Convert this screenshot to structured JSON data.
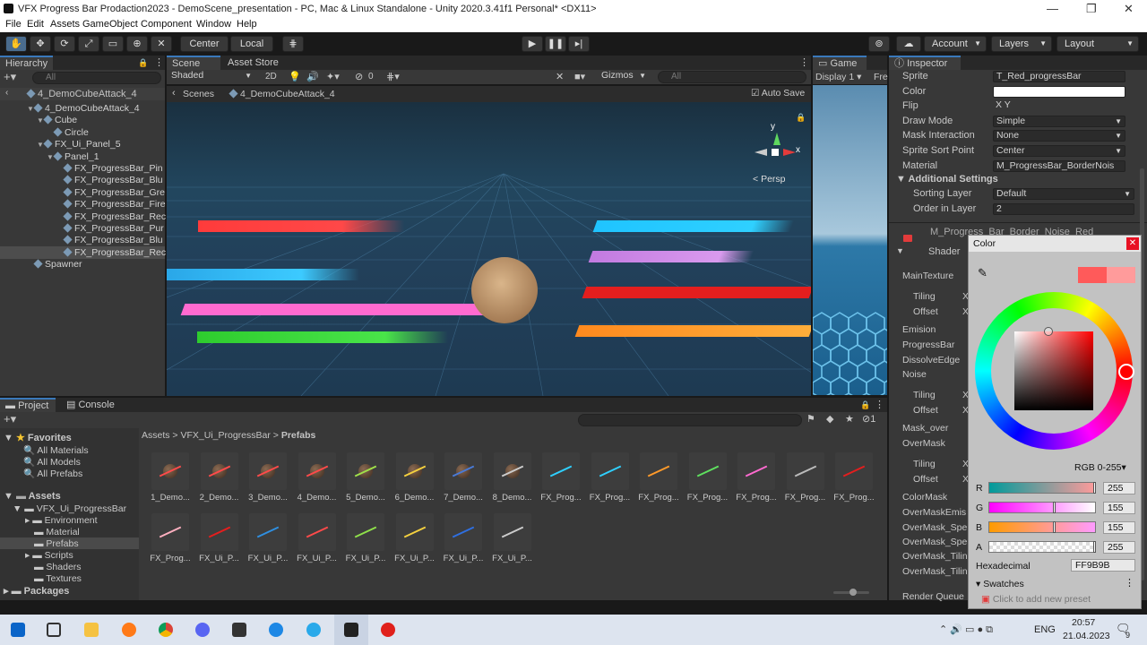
{
  "window": {
    "title": "VFX Progress Bar Prodaction2023 - DemoScene_presentation - PC, Mac & Linux Standalone - Unity 2020.3.41f1 Personal* <DX11>"
  },
  "menu": [
    "File",
    "Edit",
    "Assets",
    "GameObject",
    "Component",
    "Window",
    "Help"
  ],
  "toolbar": {
    "pivot": "Center",
    "space": "Local",
    "account": "Account",
    "layers": "Layers",
    "layout": "Layout"
  },
  "hierarchy": {
    "tab": "Hierarchy",
    "search_placeholder": "All",
    "scene_root": "4_DemoCubeAttack_4",
    "items": [
      {
        "label": "4_DemoCubeAttack_4",
        "depth": 1,
        "expand": "▼"
      },
      {
        "label": "Cube",
        "depth": 2,
        "expand": "▼"
      },
      {
        "label": "Circle",
        "depth": 3,
        "expand": ""
      },
      {
        "label": "FX_Ui_Panel_5",
        "depth": 2,
        "expand": "▼"
      },
      {
        "label": "Panel_1",
        "depth": 3,
        "expand": "▼"
      },
      {
        "label": "FX_ProgressBar_Pin",
        "depth": 4,
        "expand": ""
      },
      {
        "label": "FX_ProgressBar_Blu",
        "depth": 4,
        "expand": ""
      },
      {
        "label": "FX_ProgressBar_Gre",
        "depth": 4,
        "expand": ""
      },
      {
        "label": "FX_ProgressBar_Fire",
        "depth": 4,
        "expand": ""
      },
      {
        "label": "FX_ProgressBar_Rec",
        "depth": 4,
        "expand": ""
      },
      {
        "label": "FX_ProgressBar_Pur",
        "depth": 4,
        "expand": ""
      },
      {
        "label": "FX_ProgressBar_Blu",
        "depth": 4,
        "expand": ""
      },
      {
        "label": "FX_ProgressBar_Rec",
        "depth": 4,
        "expand": ""
      },
      {
        "label": "Spawner",
        "depth": 1,
        "expand": ""
      }
    ]
  },
  "scene": {
    "tabs": [
      "Scene",
      "Asset Store"
    ],
    "shading": "Shaded",
    "mode2d": "2D",
    "fx_count": "0",
    "gizmos": "Gizmos",
    "search_placeholder": "All",
    "breadcrumb_root": "Scenes",
    "breadcrumb_scene": "4_DemoCubeAttack_4",
    "autosave": "Auto Save",
    "persp": "Persp",
    "gizmo_y": "y",
    "gizmo_x": "x"
  },
  "game": {
    "tab": "Game",
    "display": "Display 1",
    "free": "Fre"
  },
  "inspector": {
    "tab": "Inspector",
    "rows": [
      {
        "label": "Sprite",
        "value": "T_Red_progressBar"
      },
      {
        "label": "Color",
        "value": ""
      },
      {
        "label": "Flip",
        "value": "X    Y"
      },
      {
        "label": "Draw Mode",
        "value": "Simple"
      },
      {
        "label": "Mask Interaction",
        "value": "None"
      },
      {
        "label": "Sprite Sort Point",
        "value": "Center"
      },
      {
        "label": "Material",
        "value": "M_ProgressBar_BorderNois"
      }
    ],
    "additional": "Additional Settings",
    "sorting_layer_label": "Sorting Layer",
    "sorting_layer": "Default",
    "order_label": "Order in Layer",
    "order": "2",
    "material_name": "M_Progress_Bar_Border_Noise_Red",
    "shader_label": "Shader",
    "props": [
      "MainTexture",
      "Tiling",
      "Offset",
      "Emision",
      "ProgressBar",
      "DissolveEdge",
      "Noise",
      "Tiling",
      "Offset",
      "Mask_over",
      "OverMask",
      "Tiling",
      "Offset",
      "ColorMask",
      "OverMaskEmis",
      "OverMask_Spe",
      "OverMask_Spe",
      "OverMask_Tilin",
      "OverMask_Tilin",
      "Render Queue"
    ],
    "x": "X"
  },
  "color_picker": {
    "title": "Color",
    "mode": "RGB 0-255",
    "channels": [
      {
        "name": "R",
        "value": "255"
      },
      {
        "name": "G",
        "value": "155"
      },
      {
        "name": "B",
        "value": "155"
      },
      {
        "name": "A",
        "value": "255"
      }
    ],
    "hex_label": "Hexadecimal",
    "hex": "FF9B9B",
    "swatches": "Swatches",
    "swatch_hint": "Click to add new preset",
    "colors": {
      "current": "#ff9b9b",
      "previous": "#ff5a5a"
    }
  },
  "project": {
    "tabs": [
      "Project",
      "Console"
    ],
    "favorites": "Favorites",
    "fav_items": [
      "All Materials",
      "All Models",
      "All Prefabs"
    ],
    "assets": "Assets",
    "folders": [
      "VFX_Ui_ProgressBar",
      "Environment",
      "Material",
      "Prefabs",
      "Scripts",
      "Shaders",
      "Textures"
    ],
    "packages": "Packages",
    "breadcrumb": [
      "Assets",
      "VFX_Ui_ProgressBar",
      "Prefabs"
    ],
    "hidden_count": "1",
    "row1": [
      "1_Demo...",
      "2_Demo...",
      "3_Demo...",
      "4_Demo...",
      "5_Demo...",
      "6_Demo...",
      "7_Demo...",
      "8_Demo...",
      "FX_Prog...",
      "FX_Prog...",
      "FX_Prog...",
      "FX_Prog...",
      "FX_Prog...",
      "FX_Prog...",
      "FX_Prog..."
    ],
    "row2": [
      "FX_Prog...",
      "FX_Ui_P...",
      "FX_Ui_P...",
      "FX_Ui_P...",
      "FX_Ui_P...",
      "FX_Ui_P...",
      "FX_Ui_P...",
      "FX_Ui_P..."
    ]
  },
  "taskbar": {
    "lang": "ENG",
    "time": "20:57",
    "date": "21.04.2023",
    "notif": "9"
  }
}
